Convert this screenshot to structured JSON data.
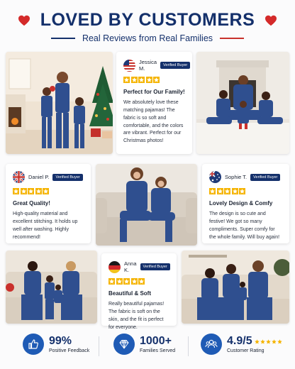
{
  "header": {
    "title": "LOVED BY CUSTOMERS",
    "subtitle": "Real Reviews from Real Families",
    "heart_color": "#d42a2a"
  },
  "colors": {
    "navy": "#14306b",
    "star": "#f5b400",
    "accent_red": "#c8312b",
    "pajama_blue": "#2f4f8f"
  },
  "photos": [
    {
      "id": "photo-christmas-family",
      "scene": "Mother and three children in matching blue pajamas beside a Christmas tree"
    },
    {
      "id": "photo-fireplace-family",
      "scene": "Mother and four children in matching blue pajamas on a rug by a fireplace"
    },
    {
      "id": "photo-sofa-duo",
      "scene": "Mother and son in matching blue pajamas on a beige sofa"
    },
    {
      "id": "photo-sofa-group",
      "scene": "Two women and two children in matching blue pajamas on a sofa"
    },
    {
      "id": "photo-sofa-family-right",
      "scene": "Two women and a child in matching blue pajamas on a sofa"
    }
  ],
  "reviews": [
    {
      "name": "Jessica M.",
      "badge": "Verified Buyer",
      "flag": "us-flag",
      "rating": 5,
      "title": "Perfect for Our Family!",
      "body": "We absolutely love these matching pajamas! The fabric is so soft and comfortable, and the colors are vibrant. Perfect for our Christmas photos!"
    },
    {
      "name": "Daniel P.",
      "badge": "Verified Buyer",
      "flag": "uk-flag",
      "rating": 5,
      "title": "Great Quality!",
      "body": "High-quality material and excellent stitching. It holds up well after washing. Highly recommend!"
    },
    {
      "name": "Sophie T.",
      "badge": "Verified Buyer",
      "flag": "au-flag",
      "rating": 5,
      "title": "Lovely Design & Comfy",
      "body": "The design is so cute and festive! We got so many compliments. Super comfy for the whole family. Will buy again!"
    },
    {
      "name": "Anna K.",
      "badge": "Verified Buyer",
      "flag": "de-flag",
      "rating": 5,
      "title": "Beautiful & Soft",
      "body": "Really beautiful pajamas! The fabric is soft on the skin, and the fit is perfect for everyone."
    }
  ],
  "stats": [
    {
      "icon": "thumbs-up-icon",
      "value": "99%",
      "label": "Positive Feedback"
    },
    {
      "icon": "diamond-icon",
      "value": "1000+",
      "label": "Families Served"
    },
    {
      "icon": "people-icon",
      "value": "4.9/5",
      "label": "Customer Rating",
      "stars": 5
    }
  ]
}
